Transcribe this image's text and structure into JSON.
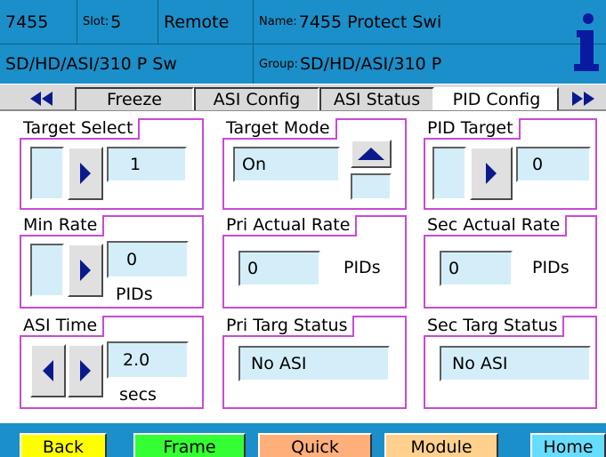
{
  "header": {
    "model": "7455",
    "slot_label": "Slot:",
    "slot_value": "5",
    "mode": "Remote",
    "name_label": "Name:",
    "name_value": "7455 Protect Swi",
    "description": "SD/HD/ASI/310 P Sw",
    "group_label": "Group:",
    "group_value": "SD/HD/ASI/310 P",
    "info_icon": "info-icon"
  },
  "tabs": {
    "prev_icon": "double-left-arrow-icon",
    "next_icon": "double-right-arrow-icon",
    "items": [
      "Freeze",
      "ASI Config",
      "ASI Status",
      "PID Config"
    ],
    "active": "PID Config"
  },
  "panels": {
    "target_select": {
      "title": "Target Select",
      "value": "1"
    },
    "target_mode": {
      "title": "Target Mode",
      "value": "On"
    },
    "pid_target": {
      "title": "PID Target",
      "value": "0"
    },
    "min_rate": {
      "title": "Min Rate",
      "value": "0",
      "unit": "PIDs"
    },
    "pri_actual_rate": {
      "title": "Pri Actual Rate",
      "value": "0",
      "unit": "PIDs"
    },
    "sec_actual_rate": {
      "title": "Sec Actual Rate",
      "value": "0",
      "unit": "PIDs"
    },
    "asi_time": {
      "title": "ASI Time",
      "value": "2.0",
      "unit": "secs"
    },
    "pri_targ_status": {
      "title": "Pri Targ Status",
      "value": "No ASI"
    },
    "sec_targ_status": {
      "title": "Sec Targ Status",
      "value": "No ASI"
    }
  },
  "footer": {
    "back": "Back",
    "frame": "Frame",
    "quick": "Quick",
    "module": "Module",
    "home": "Home"
  },
  "colors": {
    "header_blue": "#1b8fc9",
    "panel_border": "#c94ad6",
    "field_fill": "#d4eef9",
    "arrow_navy": "#0a1a8c",
    "back_yellow": "#ffff00",
    "frame_green": "#33ff33",
    "quick_orange": "#ffb07a",
    "module_peach": "#ffd18c",
    "home_cyan": "#66ddff"
  }
}
